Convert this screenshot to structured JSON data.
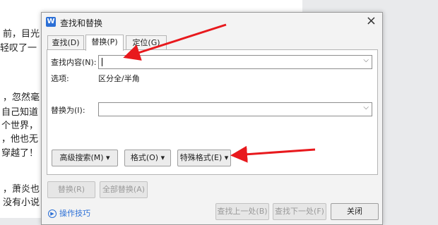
{
  "document": {
    "lines": [
      "前，目光",
      "轻叹了一",
      "，忽然毫",
      "自己知道",
      "个世界，",
      "，他也无",
      "穿越了！",
      "，萧炎也",
      "没有小说"
    ]
  },
  "dialog": {
    "title": "查找和替换",
    "app_icon": "W",
    "close_label": "×",
    "tabs": [
      "查找(D)",
      "替换(P)",
      "定位(G)"
    ],
    "active_tab": "替换(P)",
    "find_label": "查找内容(N):",
    "find_value": "",
    "options_label": "选项:",
    "options_value": "区分全/半角",
    "replace_label": "替换为(I):",
    "replace_value": "",
    "advanced_search": "高级搜索(M) ▾",
    "format_button": "格式(O) ▾",
    "special_format": "特殊格式(E) ▾",
    "replace_button": "替换(R)",
    "replace_all_button": "全部替换(A)",
    "tips_link": "操作技巧",
    "find_prev": "查找上一处(B)",
    "find_next": "查找下一处(F)",
    "close_button": "关闭"
  },
  "colors": {
    "arrow": "#e8191d",
    "accent": "#2b6fd6"
  }
}
